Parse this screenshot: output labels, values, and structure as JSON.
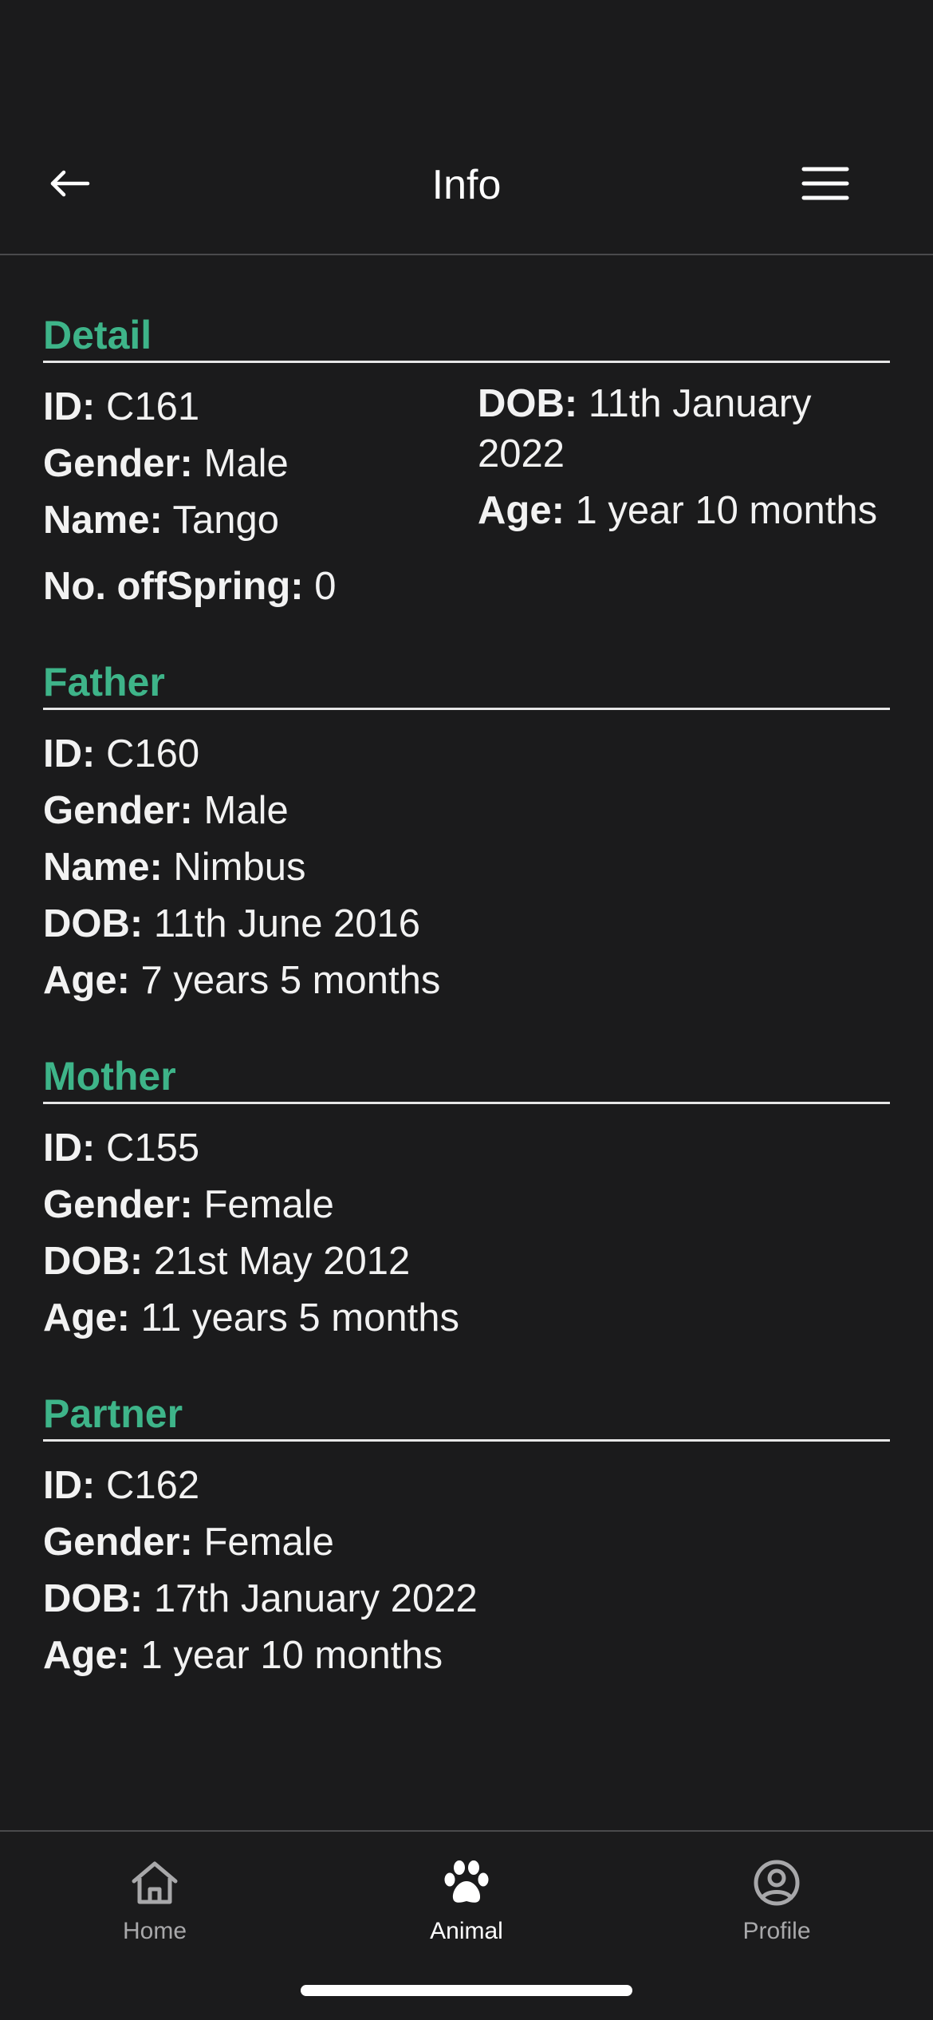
{
  "header": {
    "title": "Info",
    "back_icon": "arrow-left-icon",
    "menu_icon": "hamburger-menu-icon"
  },
  "detail": {
    "title": "Detail",
    "id_label": "ID:",
    "id_value": "C161",
    "gender_label": "Gender:",
    "gender_value": "Male",
    "name_label": "Name:",
    "name_value": "Tango",
    "dob_label": "DOB:",
    "dob_value": "11th January 2022",
    "age_label": "Age:",
    "age_value": "1 year 10 months",
    "offspring_label": "No. offSpring:",
    "offspring_value": "0"
  },
  "father": {
    "title": "Father",
    "id_label": "ID:",
    "id_value": "C160",
    "gender_label": "Gender:",
    "gender_value": "Male",
    "name_label": "Name:",
    "name_value": "Nimbus",
    "dob_label": "DOB:",
    "dob_value": "11th June 2016",
    "age_label": "Age:",
    "age_value": "7 years 5 months"
  },
  "mother": {
    "title": "Mother",
    "id_label": "ID:",
    "id_value": "C155",
    "gender_label": "Gender:",
    "gender_value": "Female",
    "dob_label": "DOB:",
    "dob_value": "21st May 2012",
    "age_label": "Age:",
    "age_value": "11 years 5 months"
  },
  "partner": {
    "title": "Partner",
    "id_label": "ID:",
    "id_value": "C162",
    "gender_label": "Gender:",
    "gender_value": "Female",
    "dob_label": "DOB:",
    "dob_value": "17th January 2022",
    "age_label": "Age:",
    "age_value": "1 year 10 months"
  },
  "nav": {
    "home_label": "Home",
    "animal_label": "Animal",
    "profile_label": "Profile",
    "active": "Animal"
  },
  "colors": {
    "background": "#1b1b1c",
    "accent": "#3eb489",
    "text": "#f2f2f2",
    "inactive": "#a8a8aa"
  }
}
